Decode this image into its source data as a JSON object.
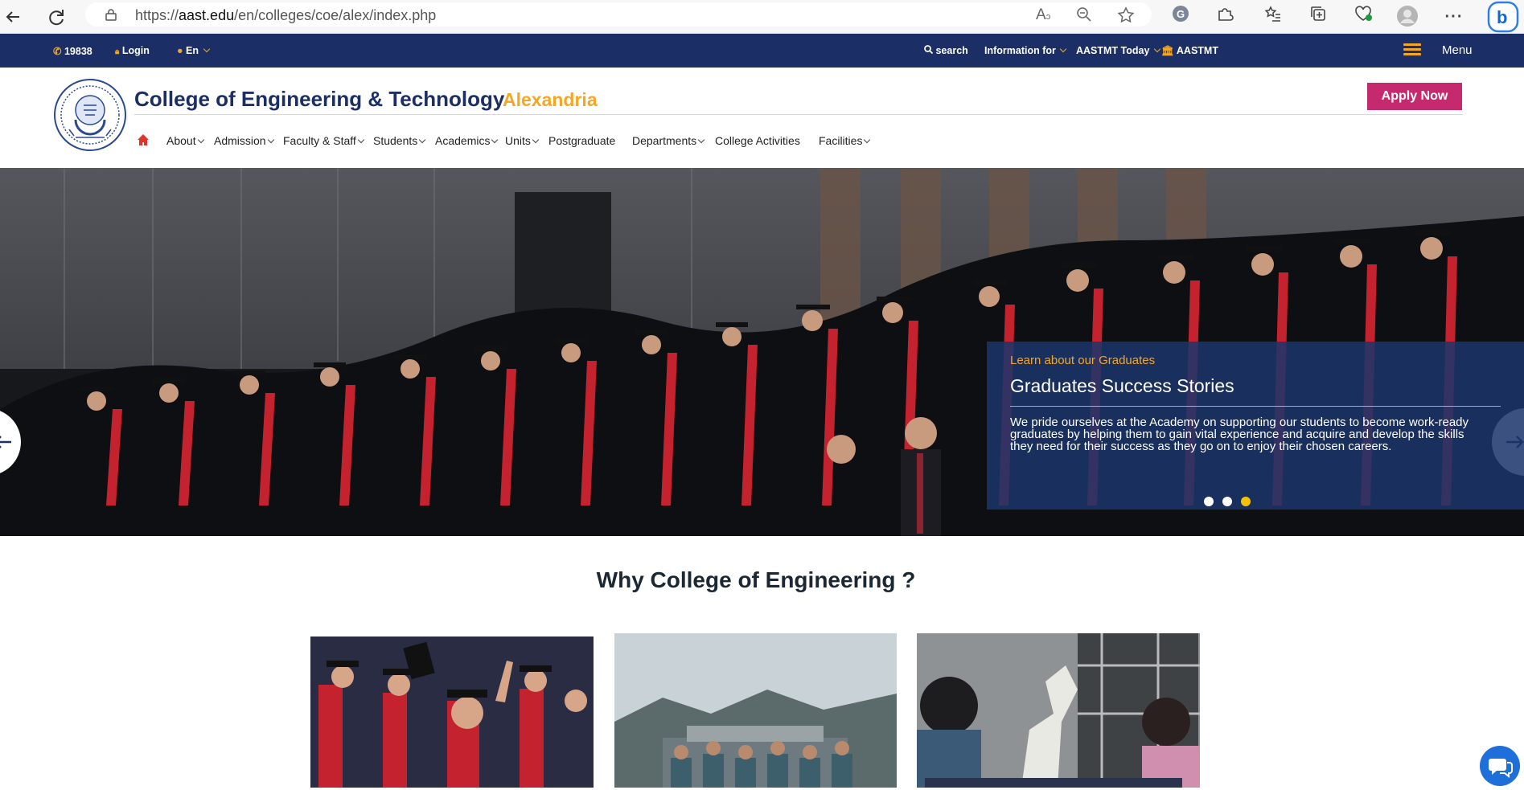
{
  "browser": {
    "url_prefix": "https://",
    "url_host": "aast.edu",
    "url_path": "/en/colleges/coe/alex/index.php",
    "back_icon": "back-arrow-icon",
    "refresh_icon": "refresh-icon"
  },
  "topbar": {
    "phone": "19838",
    "login": "Login",
    "language": "En",
    "search": "search",
    "information_for": "Information for",
    "aastmt_today": "AASTMT Today",
    "aastmt": "AASTMT",
    "menu": "Menu"
  },
  "header": {
    "title": "College of Engineering & Technology",
    "city": "Alexandria",
    "apply": "Apply Now"
  },
  "nav": {
    "items": [
      "About",
      "Admission",
      "Faculty & Staff",
      "Students",
      "Academics",
      "Units",
      "Postgraduate",
      "Departments",
      "College Activities",
      "Facilities"
    ]
  },
  "hero": {
    "kicker": "Learn about our Graduates",
    "title": "Graduates Success Stories",
    "text": "We pride ourselves at the Academy on supporting our students to become work-ready graduates by helping them to gain vital experience and acquire and develop the skills they need for their success as they go on to enjoy their chosen careers.",
    "active_slide": 3,
    "slide_count": 3
  },
  "section": {
    "title": "Why College of Engineering ?"
  },
  "colors": {
    "navy": "#1b2f66",
    "gold": "#f5a623",
    "apply": "#c52a6e",
    "dot_active": "#f5c400"
  }
}
